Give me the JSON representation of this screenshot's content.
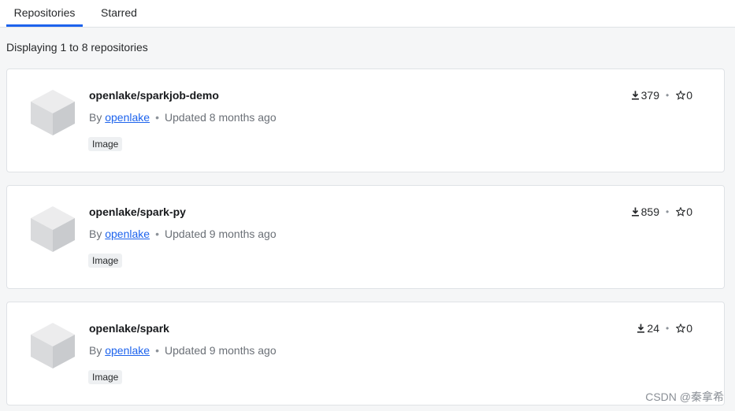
{
  "tabs": [
    {
      "label": "Repositories",
      "active": true
    },
    {
      "label": "Starred",
      "active": false
    }
  ],
  "count_text": "Displaying 1 to 8 repositories",
  "repos": [
    {
      "name": "openlake/sparkjob-demo",
      "by": "By",
      "owner": "openlake",
      "updated": "Updated 8 months ago",
      "badge": "Image",
      "downloads": "379",
      "stars": "0"
    },
    {
      "name": "openlake/spark-py",
      "by": "By",
      "owner": "openlake",
      "updated": "Updated 9 months ago",
      "badge": "Image",
      "downloads": "859",
      "stars": "0"
    },
    {
      "name": "openlake/spark",
      "by": "By",
      "owner": "openlake",
      "updated": "Updated 9 months ago",
      "badge": "Image",
      "downloads": "24",
      "stars": "0"
    }
  ],
  "separator": "•",
  "icons": {
    "repo": "cube-icon",
    "downloads": "download-icon",
    "stars": "star-icon"
  },
  "colors": {
    "accent": "#1d63ed",
    "link": "#1d63ed"
  },
  "watermark": "CSDN @秦拿希"
}
